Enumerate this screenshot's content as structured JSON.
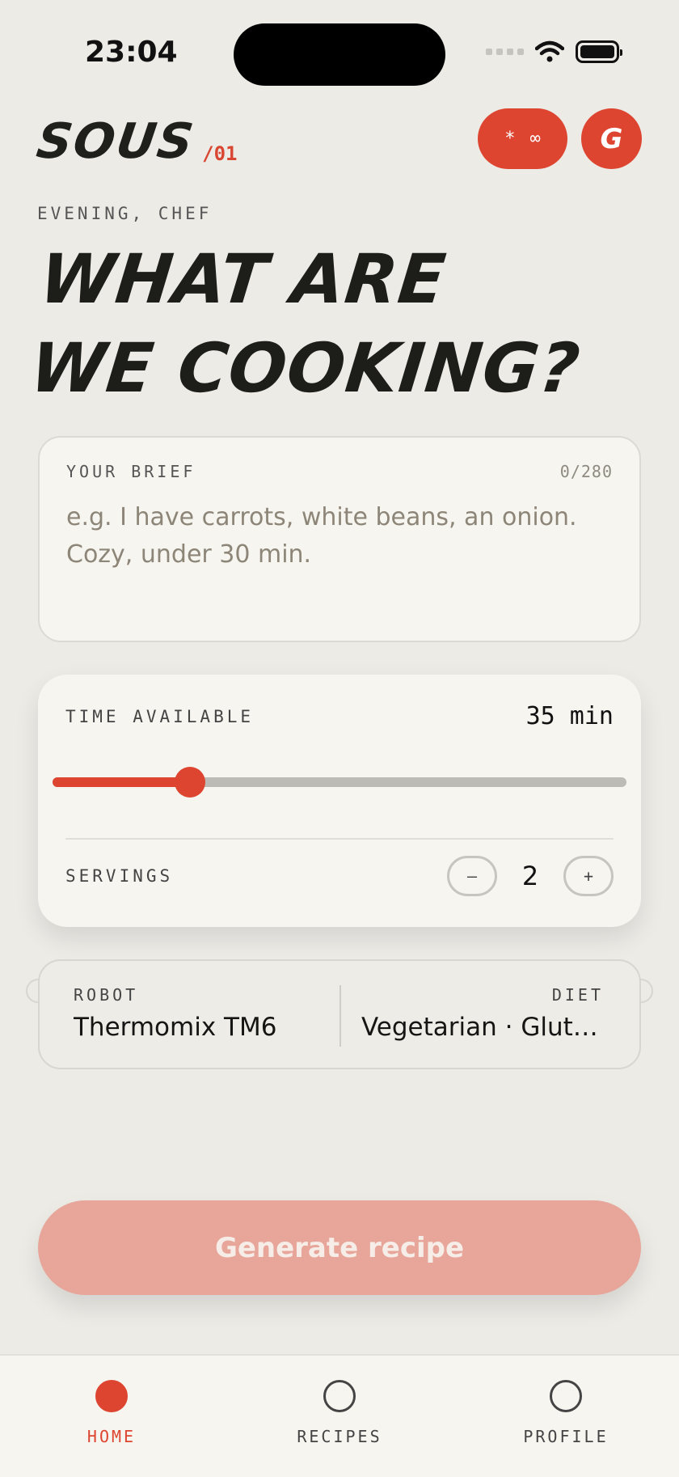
{
  "status_bar": {
    "time": "23:04"
  },
  "header": {
    "brand": "SOUS",
    "brand_sub": "/01",
    "pill_button": {
      "left": "*",
      "right": "∞"
    },
    "avatar_letter": "G"
  },
  "greeting": "EVENING, CHEF",
  "headline": {
    "line1": "WHAT ARE",
    "line2": "WE COOKING?"
  },
  "brief": {
    "label": "YOUR BRIEF",
    "count": "0/280",
    "placeholder": "e.g. I have carrots, white beans, an onion. Cozy, under 30 min."
  },
  "time": {
    "label": "TIME AVAILABLE",
    "value_text": "35 min",
    "slider_fraction": 0.24
  },
  "servings": {
    "label": "SERVINGS",
    "minus": "–",
    "value": "2",
    "plus": "+"
  },
  "preferences": {
    "robot_label": "ROBOT",
    "robot_value": "Thermomix TM6",
    "diet_label": "DIET",
    "diet_value": "Vegetarian · Gluten-free"
  },
  "generate_button": "Generate recipe",
  "tabs": [
    {
      "label": "HOME",
      "active": true
    },
    {
      "label": "RECIPES",
      "active": false
    },
    {
      "label": "PROFILE",
      "active": false
    }
  ],
  "colors": {
    "accent": "#de4531",
    "background": "#ecebe6",
    "card": "#f6f5f0",
    "generate_disabled": "#e7a699"
  }
}
